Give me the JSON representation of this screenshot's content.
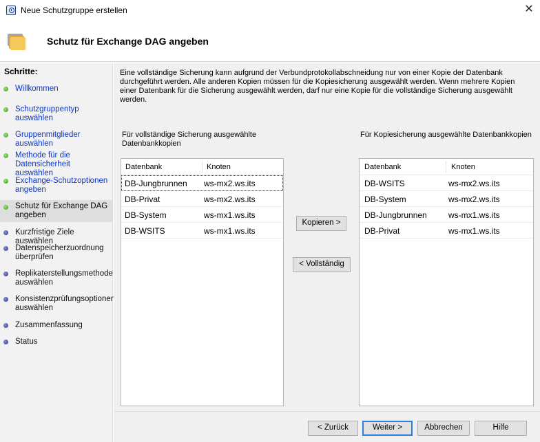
{
  "window": {
    "title": "Neue Schutzgruppe erstellen",
    "close": "✕"
  },
  "header": {
    "title": "Schutz für Exchange DAG angeben"
  },
  "steps": {
    "title": "Schritte:",
    "items": [
      {
        "label": "Willkommen",
        "status": "done"
      },
      {
        "label": "Schutzgruppentyp auswählen",
        "status": "done"
      },
      {
        "label": "Gruppenmitglieder auswählen",
        "status": "done"
      },
      {
        "label": "Methode für die Datensicherheit auswählen",
        "status": "done"
      },
      {
        "label": "Exchange-Schutzoptionen angeben",
        "status": "done"
      },
      {
        "label": "Schutz für Exchange DAG angeben",
        "status": "current"
      },
      {
        "label": "Kurzfristige Ziele auswählen",
        "status": "pending"
      },
      {
        "label": "Datenspeicherzuordnung überprüfen",
        "status": "pending"
      },
      {
        "label": "Replikaterstellungsmethode auswählen",
        "status": "pending"
      },
      {
        "label": "Konsistenzprüfungsoptionen auswählen",
        "status": "pending"
      },
      {
        "label": "Zusammenfassung",
        "status": "pending"
      },
      {
        "label": "Status",
        "status": "pending"
      }
    ]
  },
  "main": {
    "intro": "Eine vollständige Sicherung kann aufgrund der Verbundprotokollabschneidung nur von einer Kopie der Datenbank durchgeführt werden. Alle anderen Kopien müssen für die Kopiesicherung ausgewählt werden. Wenn mehrere Kopien einer Datenbank für die Sicherung ausgewählt werden, darf nur eine Kopie für die vollständige Sicherung ausgewählt werden.",
    "left_label": "Für vollständige Sicherung ausgewählte Datenbankkopien",
    "right_label": "Für Kopiesicherung ausgewählte Datenbankkopien",
    "columns": {
      "database": "Datenbank",
      "node": "Knoten"
    },
    "full_backup": [
      {
        "database": "DB-Jungbrunnen",
        "node": "ws-mx2.ws.its"
      },
      {
        "database": "DB-Privat",
        "node": "ws-mx2.ws.its"
      },
      {
        "database": "DB-System",
        "node": "ws-mx1.ws.its"
      },
      {
        "database": "DB-WSITS",
        "node": "ws-mx1.ws.its"
      }
    ],
    "copy_backup": [
      {
        "database": "DB-WSITS",
        "node": "ws-mx2.ws.its"
      },
      {
        "database": "DB-System",
        "node": "ws-mx2.ws.its"
      },
      {
        "database": "DB-Jungbrunnen",
        "node": "ws-mx1.ws.its"
      },
      {
        "database": "DB-Privat",
        "node": "ws-mx1.ws.its"
      }
    ],
    "copy_button": "Kopieren >",
    "full_button": "< Vollständig"
  },
  "footer": {
    "back": "< Zurück",
    "next": "Weiter >",
    "cancel": "Abbrechen",
    "help": "Hilfe"
  }
}
